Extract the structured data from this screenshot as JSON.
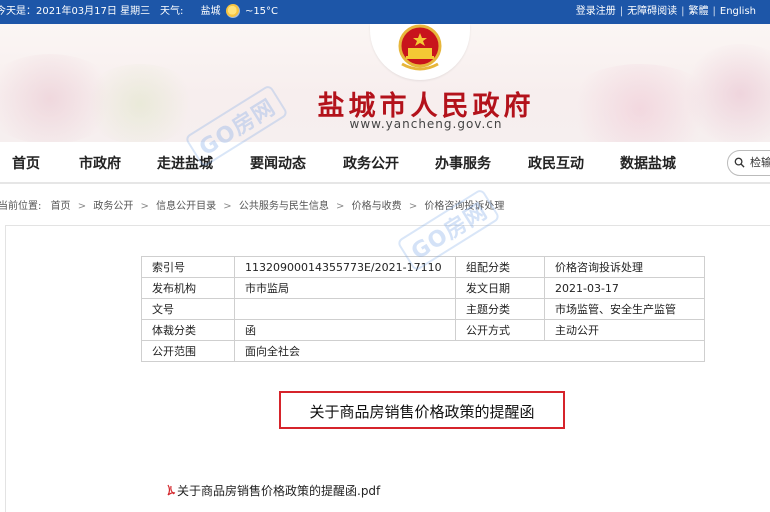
{
  "topbar": {
    "date": "今天是：2021年03月17日 星期三",
    "weather_label": "天气:",
    "city": "盐城",
    "temperature": "~15°C",
    "links": [
      "登录注册",
      "无障碍阅读",
      "繁體",
      "English"
    ],
    "color": "#1d56a8"
  },
  "site": {
    "name": "盐城市人民政府",
    "url": "www.yancheng.gov.cn",
    "name_color": "#b3121b"
  },
  "nav": {
    "items": [
      "首页",
      "市政府",
      "走进盐城",
      "要闻动态",
      "政务公开",
      "办事服务",
      "政民互动",
      "数据盐城"
    ],
    "search_placeholder": "检输入"
  },
  "breadcrumb": {
    "label": "当前位置:",
    "items": [
      "首页",
      "政务公开",
      "信息公开目录",
      "公共服务与民生信息",
      "价格与收费",
      "价格咨询投诉处理"
    ]
  },
  "meta": {
    "rows": [
      [
        "索引号",
        "11320900014355773E/2021-17110",
        "组配分类",
        "价格咨询投诉处理"
      ],
      [
        "发布机构",
        "市市监局",
        "发文日期",
        "2021-03-17"
      ],
      [
        "文号",
        "",
        "主题分类",
        "市场监管、安全生产监管"
      ],
      [
        "体裁分类",
        "函",
        "公开方式",
        "主动公开"
      ],
      [
        "公开范围",
        "面向全社会"
      ]
    ]
  },
  "document": {
    "title": "关于商品房销售价格政策的提醒函",
    "attachment": "关于商品房销售价格政策的提醒函.pdf",
    "highlight_color": "#d6242b"
  },
  "watermark": {
    "text": "GO房网"
  }
}
